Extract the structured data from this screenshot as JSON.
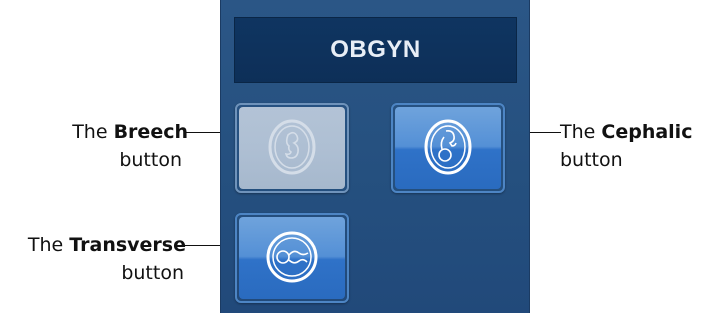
{
  "panel": {
    "title": "OBGYN"
  },
  "buttons": [
    {
      "id": "breech",
      "icon": "fetus-breech-icon",
      "state": "disabled"
    },
    {
      "id": "cephalic",
      "icon": "fetus-cephalic-icon",
      "state": "enabled"
    },
    {
      "id": "transverse",
      "icon": "fetus-transverse-icon",
      "state": "enabled"
    }
  ],
  "callouts": {
    "breech": {
      "prefix": "The ",
      "name": "Breech",
      "suffix": "button"
    },
    "cephalic": {
      "prefix": "The ",
      "name": "Cephalic",
      "suffix": "button"
    },
    "transverse": {
      "prefix": "The ",
      "name": "Transverse",
      "suffix": "button"
    }
  },
  "colors": {
    "panel_bg": "#25507f",
    "title_bar_bg": "#0f3561",
    "button_blue": "#3a7bcb",
    "button_disabled": "#aebfd3",
    "text": "#111111"
  }
}
